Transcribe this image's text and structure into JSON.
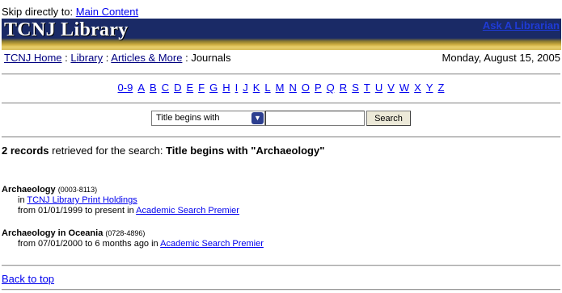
{
  "skip": {
    "prefix": "Skip directly to:",
    "link": "Main Content"
  },
  "banner": {
    "logo": "TCNJ Library",
    "ask": "Ask A Librarian"
  },
  "breadcrumb": {
    "items": [
      "TCNJ Home",
      "Library",
      "Articles & More"
    ],
    "separator": ":",
    "current": "Journals"
  },
  "date": "Monday, August 15, 2005",
  "az": [
    "0-9",
    "A",
    "B",
    "C",
    "D",
    "E",
    "F",
    "G",
    "H",
    "I",
    "J",
    "K",
    "L",
    "M",
    "N",
    "O",
    "P",
    "Q",
    "R",
    "S",
    "T",
    "U",
    "V",
    "W",
    "X",
    "Y",
    "Z"
  ],
  "search": {
    "mode": "Title begins with",
    "value": "",
    "button": "Search"
  },
  "result": {
    "count": "2 records",
    "middle": "retrieved for the search:",
    "query": "Title begins with \"Archaeology\""
  },
  "records": [
    {
      "title": "Archaeology",
      "issn": "(0003-8113)",
      "lines": [
        {
          "pre": "in ",
          "link": "TCNJ Library Print Holdings",
          "post": ""
        },
        {
          "pre": "from 01/01/1999 to present in ",
          "link": "Academic Search Premier",
          "post": ""
        }
      ]
    },
    {
      "title": "Archaeology in Oceania",
      "issn": "(0728-4896)",
      "lines": [
        {
          "pre": "from 07/01/2000 to 6 months ago in ",
          "link": "Academic Search Premier",
          "post": ""
        }
      ]
    }
  ],
  "back_to_top": "Back to top",
  "colors": {
    "banner": "#1a2a66",
    "gold": "#c9a93e",
    "link": "#0000ee",
    "ask": "#1f3bd6"
  }
}
